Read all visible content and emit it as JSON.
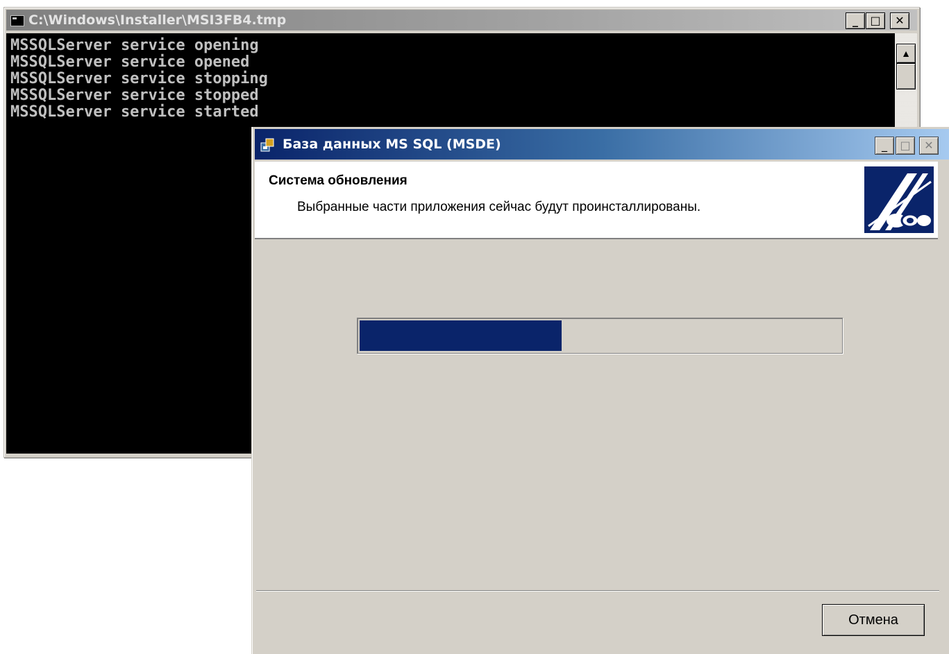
{
  "console": {
    "title": "C:\\Windows\\Installer\\MSI3FB4.tmp",
    "lines": "MSSQLServer service opening\nMSSQLServer service opened\nMSSQLServer service stopping\nMSSQLServer service stopped\nMSSQLServer service started",
    "buttons": {
      "minimize": "_",
      "maximize": "□",
      "close": "✕"
    }
  },
  "dialog": {
    "title": "База данных MS SQL (MSDE)",
    "buttons": {
      "minimize": "_",
      "maximize": "□",
      "close": "✕"
    },
    "header": {
      "title": "Система обновления",
      "description": "Выбранные части приложения сейчас будут проинсталлированы."
    },
    "progress_percent": 42,
    "cancel_label": "Отмена",
    "accent_color": "#0a246a"
  }
}
